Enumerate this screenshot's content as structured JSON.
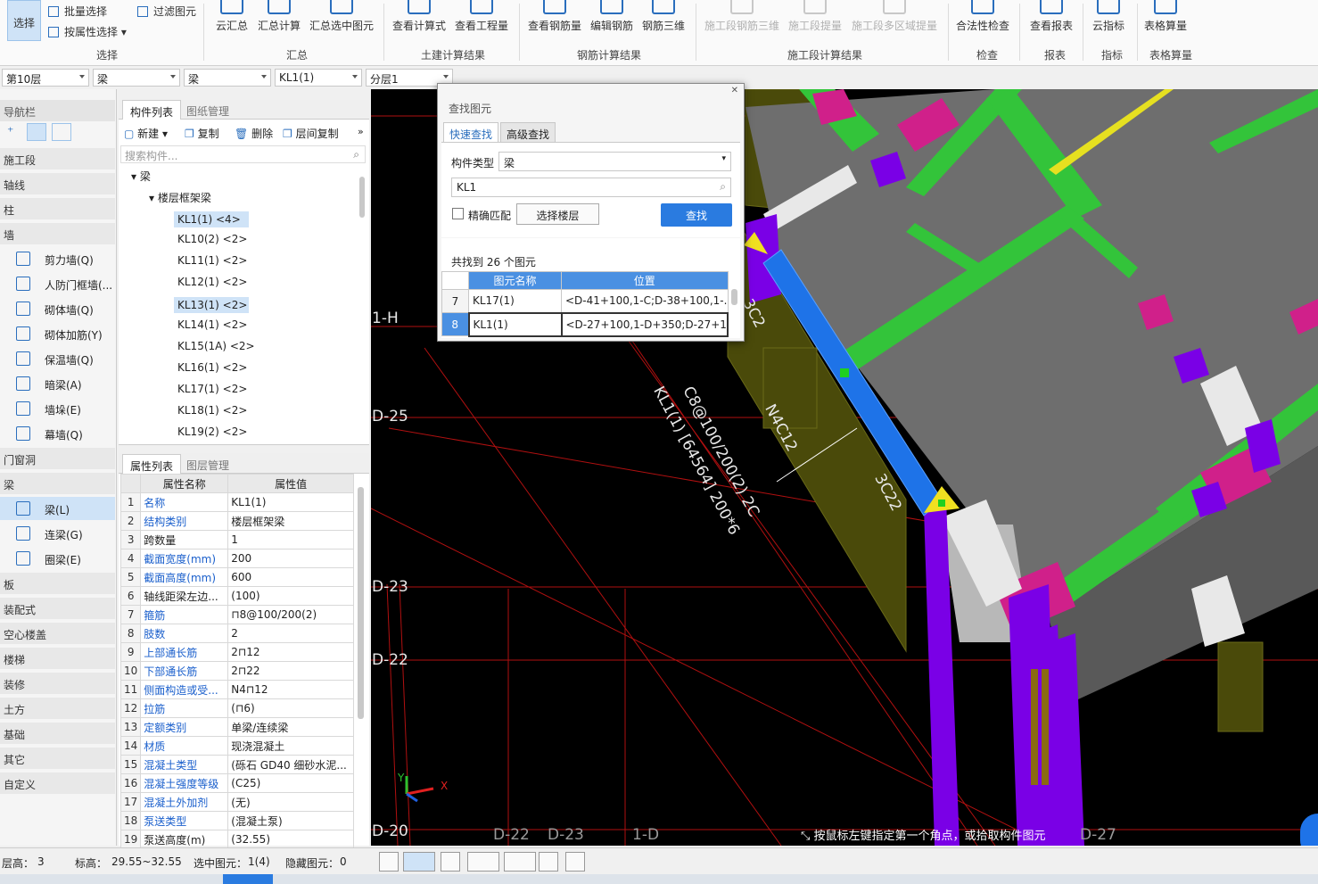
{
  "ribbon": {
    "select": "选择",
    "batch_select": "批量选择",
    "filter_elem": "过滤图元",
    "prop_select": "按属性选择",
    "cloud_summary": "云汇总",
    "summary_calc": "汇总计算",
    "summary_sel": "汇总选中图元",
    "view_formula": "查看计算式",
    "view_quantity": "查看工程量",
    "view_rebar": "查看钢筋量",
    "edit_rebar": "编辑钢筋",
    "rebar_3d": "钢筋三维",
    "stage_rebar3d": "施工段钢筋三维",
    "stage_extract": "施工段提量",
    "stage_multi": "施工段多区域提量",
    "legality": "合法性检查",
    "view_report": "查看报表",
    "cloud_index": "云指标",
    "table_calc": "表格算量",
    "g_select": "选择",
    "g_summary": "汇总",
    "g_civil": "土建计算结果",
    "g_rebar": "钢筋计算结果",
    "g_stage": "施工段计算结果",
    "g_check": "检查",
    "g_report": "报表",
    "g_index": "指标",
    "g_table": "表格算量"
  },
  "combos": {
    "floor": "第10层",
    "cat1": "梁",
    "cat2": "梁",
    "comp": "KL1(1)",
    "layer": "分层1"
  },
  "nav": {
    "title": "导航栏",
    "cats": [
      "施工段",
      "轴线",
      "柱",
      "墙",
      "门窗洞",
      "梁",
      "板",
      "装配式",
      "空心楼盖",
      "楼梯",
      "装修",
      "土方",
      "基础",
      "其它",
      "自定义"
    ],
    "wall_items": [
      "剪力墙(Q)",
      "人防门框墙(...",
      "砌体墙(Q)",
      "砌体加筋(Y)",
      "保温墙(Q)",
      "暗梁(A)",
      "墙垛(E)",
      "幕墙(Q)"
    ],
    "beam_items": [
      "梁(L)",
      "连梁(G)",
      "圈梁(E)"
    ]
  },
  "comp": {
    "tab_list": "构件列表",
    "tab_drawing": "图纸管理",
    "new": "新建",
    "copy": "复制",
    "del": "删除",
    "floor_copy": "层间复制",
    "search_ph": "搜索构件...",
    "root": "梁",
    "group": "楼层框架梁",
    "items": [
      "KL1(1) <4>",
      "KL10(2) <2>",
      "KL11(1) <2>",
      "KL12(1) <2>",
      "KL13(1) <2>",
      "KL14(1) <2>",
      "KL15(1A) <2>",
      "KL16(1) <2>",
      "KL17(1) <2>",
      "KL18(1) <2>",
      "KL19(2) <2>"
    ]
  },
  "props": {
    "tab_prop": "属性列表",
    "tab_layer": "图层管理",
    "h_name": "属性名称",
    "h_val": "属性值",
    "rows": [
      [
        "1",
        "名称",
        "KL1(1)"
      ],
      [
        "2",
        "结构类别",
        "楼层框架梁"
      ],
      [
        "3",
        "跨数量",
        "1"
      ],
      [
        "4",
        "截面宽度(mm)",
        "200"
      ],
      [
        "5",
        "截面高度(mm)",
        "600"
      ],
      [
        "6",
        "轴线距梁左边...",
        "(100)"
      ],
      [
        "7",
        "箍筋",
        "⊓8@100/200(2)"
      ],
      [
        "8",
        "肢数",
        "2"
      ],
      [
        "9",
        "上部通长筋",
        "2⊓12"
      ],
      [
        "10",
        "下部通长筋",
        "2⊓22"
      ],
      [
        "11",
        "侧面构造或受...",
        "N4⊓12"
      ],
      [
        "12",
        "拉筋",
        "(⊓6)"
      ],
      [
        "13",
        "定额类别",
        "单梁/连续梁"
      ],
      [
        "14",
        "材质",
        "现浇混凝土"
      ],
      [
        "15",
        "混凝土类型",
        "(砾石 GD40 细砂水泥..."
      ],
      [
        "16",
        "混凝土强度等级",
        "(C25)"
      ],
      [
        "17",
        "混凝土外加剂",
        "(无)"
      ],
      [
        "18",
        "泵送类型",
        "(混凝土泵)"
      ],
      [
        "19",
        "泵送高度(m)",
        "(32.55)"
      ]
    ]
  },
  "dialog": {
    "title": "查找图元",
    "tab_quick": "快速查找",
    "tab_adv": "高级查找",
    "type_label": "构件类型",
    "type_val": "梁",
    "search_val": "KL1",
    "exact": "精确匹配",
    "sel_floor": "选择楼层",
    "find": "查找",
    "found": "共找到 26 个图元",
    "h_name": "图元名称",
    "h_pos": "位置",
    "rows": [
      [
        "7",
        "KL17(1)",
        "<D-41+100,1-C;D-38+100,1-..."
      ],
      [
        "8",
        "KL1(1)",
        "<D-27+100,1-D+350;D-27+1..."
      ]
    ]
  },
  "view": {
    "axes_left": [
      "1-H",
      "D-25",
      "D-23",
      "D-22",
      "D-20"
    ],
    "axes_bottom": [
      "D-22",
      "D-23",
      "1-D",
      "D-27"
    ],
    "beam_text1": "KL1(1) [64564] 200*6",
    "beam_text2": "C8@100/200(2) 2C",
    "beam_text3": "N4C12",
    "beam_text4": "3C22",
    "beam_text5": "3C2",
    "hint": "按鼠标左键指定第一个角点，或拾取构件图元",
    "ax_x": "X",
    "ax_y": "Y"
  },
  "status": {
    "floor_h": "层高：",
    "floor_h_v": "3",
    "elev": "标高：",
    "elev_v": "29.55~32.55",
    "selected": "选中图元：",
    "selected_v": "1(4)",
    "hidden": "隐藏图元：",
    "hidden_v": "0"
  },
  "colors": {
    "accent": "#2a6ebd",
    "selection": "#cfe3f7",
    "beam_blue": "#1e73e8",
    "green": "#33cc33",
    "magenta": "#d0208a",
    "purple": "#7a00e6",
    "slab": "#6a6a6a",
    "olive": "#5a5a10"
  }
}
